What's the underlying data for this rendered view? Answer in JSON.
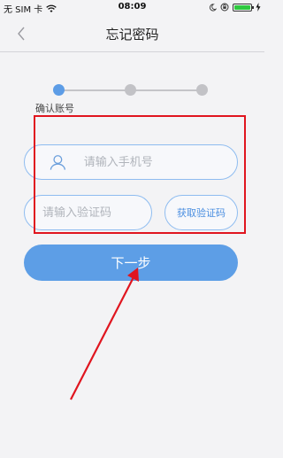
{
  "status_bar": {
    "carrier": "无 SIM 卡",
    "time": "08:09",
    "battery_color": "#2ec93f"
  },
  "nav": {
    "title": "忘记密码",
    "back_icon": "chevron-left-icon"
  },
  "steps": {
    "current_label": "确认账号",
    "total": 3,
    "current": 1,
    "active_color": "#5c9ce6",
    "inactive_color": "#c2c2c6"
  },
  "form": {
    "phone": {
      "placeholder": "请输入手机号",
      "value": "",
      "icon": "user-icon"
    },
    "code": {
      "placeholder": "请输入验证码",
      "value": ""
    },
    "get_code_label": "获取验证码",
    "next_label": "下一步",
    "border_color": "#8ebcf0",
    "button_color": "#5d9ee6"
  },
  "annotation": {
    "color": "#e0151f"
  }
}
